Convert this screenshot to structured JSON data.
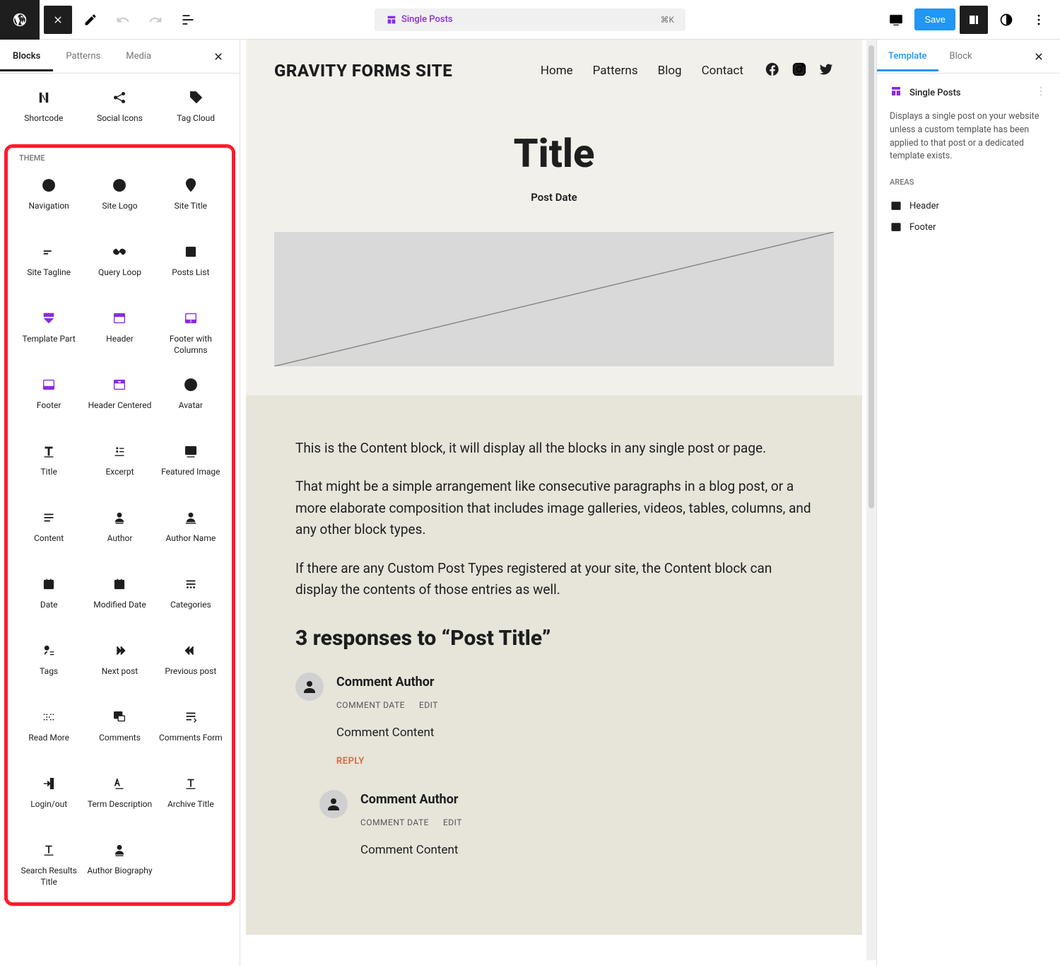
{
  "topbar": {
    "template_label": "Single Posts",
    "kbd": "⌘K",
    "save": "Save"
  },
  "inserter": {
    "tabs": {
      "blocks": "Blocks",
      "patterns": "Patterns",
      "media": "Media"
    },
    "widgets_row": [
      {
        "label": "Shortcode",
        "icon": "shortcode"
      },
      {
        "label": "Social Icons",
        "icon": "share"
      },
      {
        "label": "Tag Cloud",
        "icon": "tag"
      }
    ],
    "theme_label": "THEME",
    "theme_blocks": [
      {
        "label": "Navigation",
        "icon": "compass"
      },
      {
        "label": "Site Logo",
        "icon": "circle-doughnut"
      },
      {
        "label": "Site Title",
        "icon": "map-pin"
      },
      {
        "label": "Site Tagline",
        "icon": "tagline"
      },
      {
        "label": "Query Loop",
        "icon": "loop"
      },
      {
        "label": "Posts List",
        "icon": "posts-list"
      },
      {
        "label": "Template Part",
        "icon": "template-part",
        "purple": true
      },
      {
        "label": "Header",
        "icon": "header",
        "purple": true
      },
      {
        "label": "Footer with Columns",
        "icon": "footer-cols",
        "purple": true
      },
      {
        "label": "Footer",
        "icon": "footer",
        "purple": true
      },
      {
        "label": "Header Centered",
        "icon": "header-centered",
        "purple": true
      },
      {
        "label": "Avatar",
        "icon": "avatar"
      },
      {
        "label": "Title",
        "icon": "title-t"
      },
      {
        "label": "Excerpt",
        "icon": "excerpt"
      },
      {
        "label": "Featured Image",
        "icon": "featured-image"
      },
      {
        "label": "Content",
        "icon": "content"
      },
      {
        "label": "Author",
        "icon": "author"
      },
      {
        "label": "Author Name",
        "icon": "author-name"
      },
      {
        "label": "Date",
        "icon": "date"
      },
      {
        "label": "Modified Date",
        "icon": "modified-date"
      },
      {
        "label": "Categories",
        "icon": "categories"
      },
      {
        "label": "Tags",
        "icon": "tags"
      },
      {
        "label": "Next post",
        "icon": "next-post"
      },
      {
        "label": "Previous post",
        "icon": "prev-post"
      },
      {
        "label": "Read More",
        "icon": "read-more"
      },
      {
        "label": "Comments",
        "icon": "comments"
      },
      {
        "label": "Comments Form",
        "icon": "comments-form"
      },
      {
        "label": "Login/out",
        "icon": "login"
      },
      {
        "label": "Term Description",
        "icon": "term-desc"
      },
      {
        "label": "Archive Title",
        "icon": "archive-title"
      },
      {
        "label": "Search Results Title",
        "icon": "search-results"
      },
      {
        "label": "Author Biography",
        "icon": "author-bio"
      }
    ]
  },
  "canvas": {
    "site_title": "GRAVITY FORMS SITE",
    "nav": [
      "Home",
      "Patterns",
      "Blog",
      "Contact"
    ],
    "post_title": "Title",
    "post_date": "Post Date",
    "p1": "This is the Content block, it will display all the blocks in any single post or page.",
    "p2": "That might be a simple arrangement like consecutive paragraphs in a blog post, or a more elaborate composition that includes image galleries, videos, tables, columns, and any other block types.",
    "p3": "If there are any Custom Post Types registered at your site, the Content block can display the contents of those entries as well.",
    "comments_title": "3 responses to “Post Title”",
    "comment_author": "Comment Author",
    "comment_date": "COMMENT DATE",
    "edit": "EDIT",
    "comment_content": "Comment Content",
    "reply": "REPLY"
  },
  "right": {
    "tab_template": "Template",
    "tab_block": "Block",
    "title": "Single Posts",
    "desc": "Displays a single post on your website unless a custom template has been applied to that post or a dedicated template exists.",
    "areas_label": "AREAS",
    "areas": [
      "Header",
      "Footer"
    ]
  }
}
